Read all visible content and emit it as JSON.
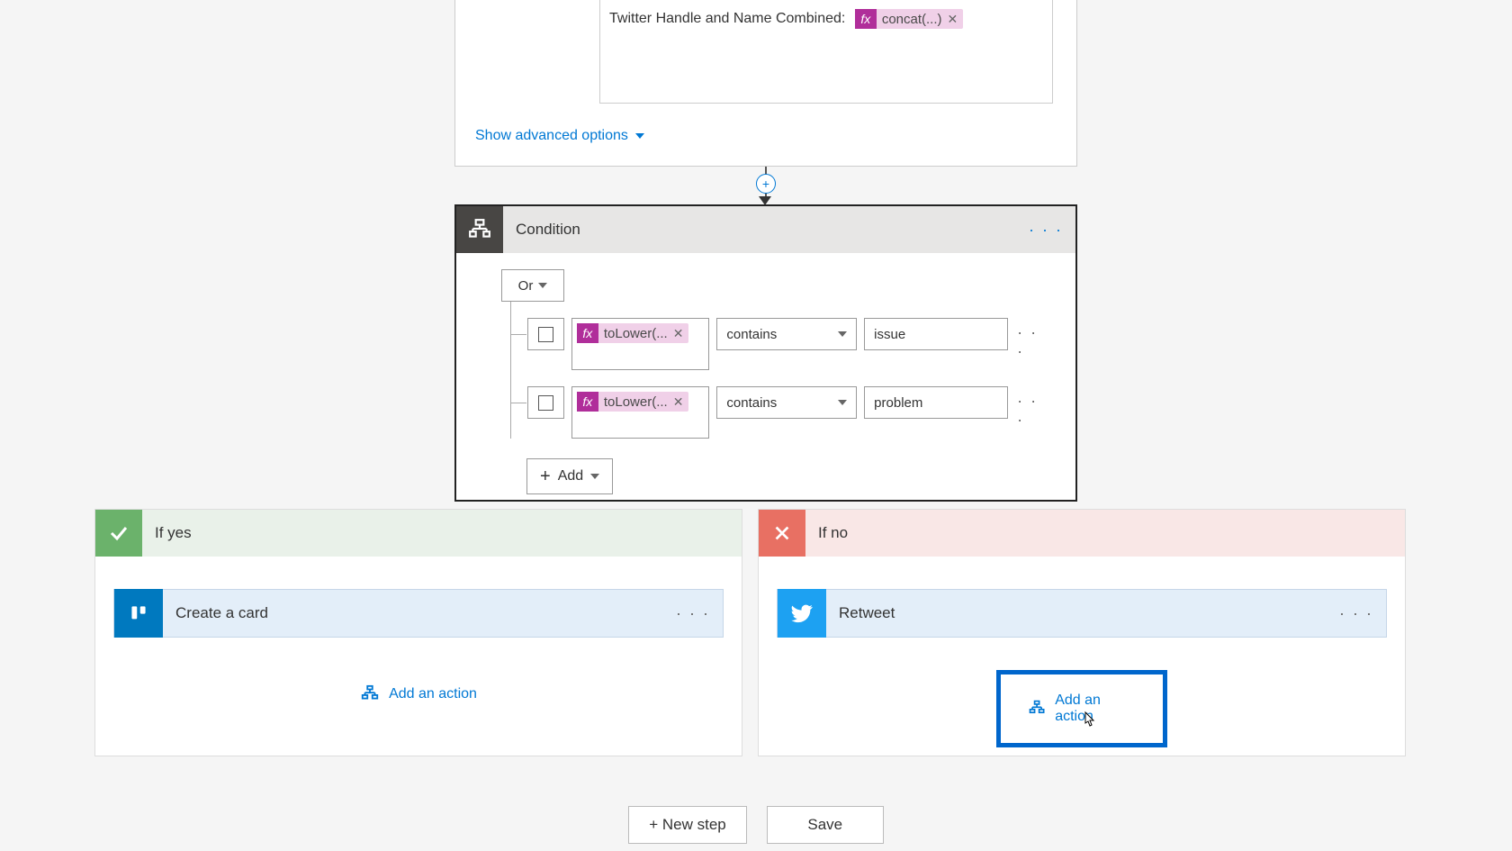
{
  "top": {
    "field_label": "Twitter Handle and Name Combined:",
    "token_fx": "fx",
    "token_text": "concat(...)",
    "show_advanced": "Show advanced options"
  },
  "condition": {
    "title": "Condition",
    "group_operator": "Or",
    "rows": [
      {
        "fx": "fx",
        "expr": "toLower(...",
        "op": "contains",
        "val": "issue"
      },
      {
        "fx": "fx",
        "expr": "toLower(...",
        "op": "contains",
        "val": "problem"
      }
    ],
    "add_label": "Add"
  },
  "branches": {
    "yes": {
      "title": "If yes",
      "action": "Create a card",
      "add_action": "Add an action"
    },
    "no": {
      "title": "If no",
      "action": "Retweet",
      "add_action": "Add an action"
    }
  },
  "bottom": {
    "new_step": "+ New step",
    "save": "Save"
  }
}
